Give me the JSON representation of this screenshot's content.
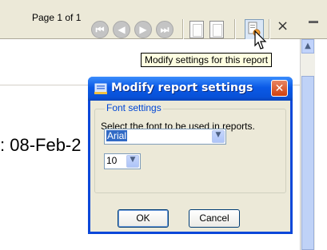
{
  "toolbar": {
    "page_label": "Page 1 of 1",
    "nav_buttons": [
      {
        "icon": "first-page-icon",
        "glyph": "⏮"
      },
      {
        "icon": "prev-page-icon",
        "glyph": "◀"
      },
      {
        "icon": "next-page-icon",
        "glyph": "▶"
      },
      {
        "icon": "last-page-icon",
        "glyph": "⏭"
      }
    ],
    "close_glyph": "×"
  },
  "tooltip": "Modify settings for this report",
  "document": {
    "date_fragment": ": 08-Feb-2"
  },
  "dialog": {
    "title": "Modify report settings",
    "close_glyph": "✕",
    "group_label": "Font settings",
    "instruction": "Select the font to be used in reports.",
    "font_value": "Arial",
    "size_value": "10",
    "ok_label": "OK",
    "cancel_label": "Cancel"
  },
  "colors": {
    "titlebar": "#0a59e6",
    "legend": "#0046d5",
    "selection": "#316ac5"
  }
}
